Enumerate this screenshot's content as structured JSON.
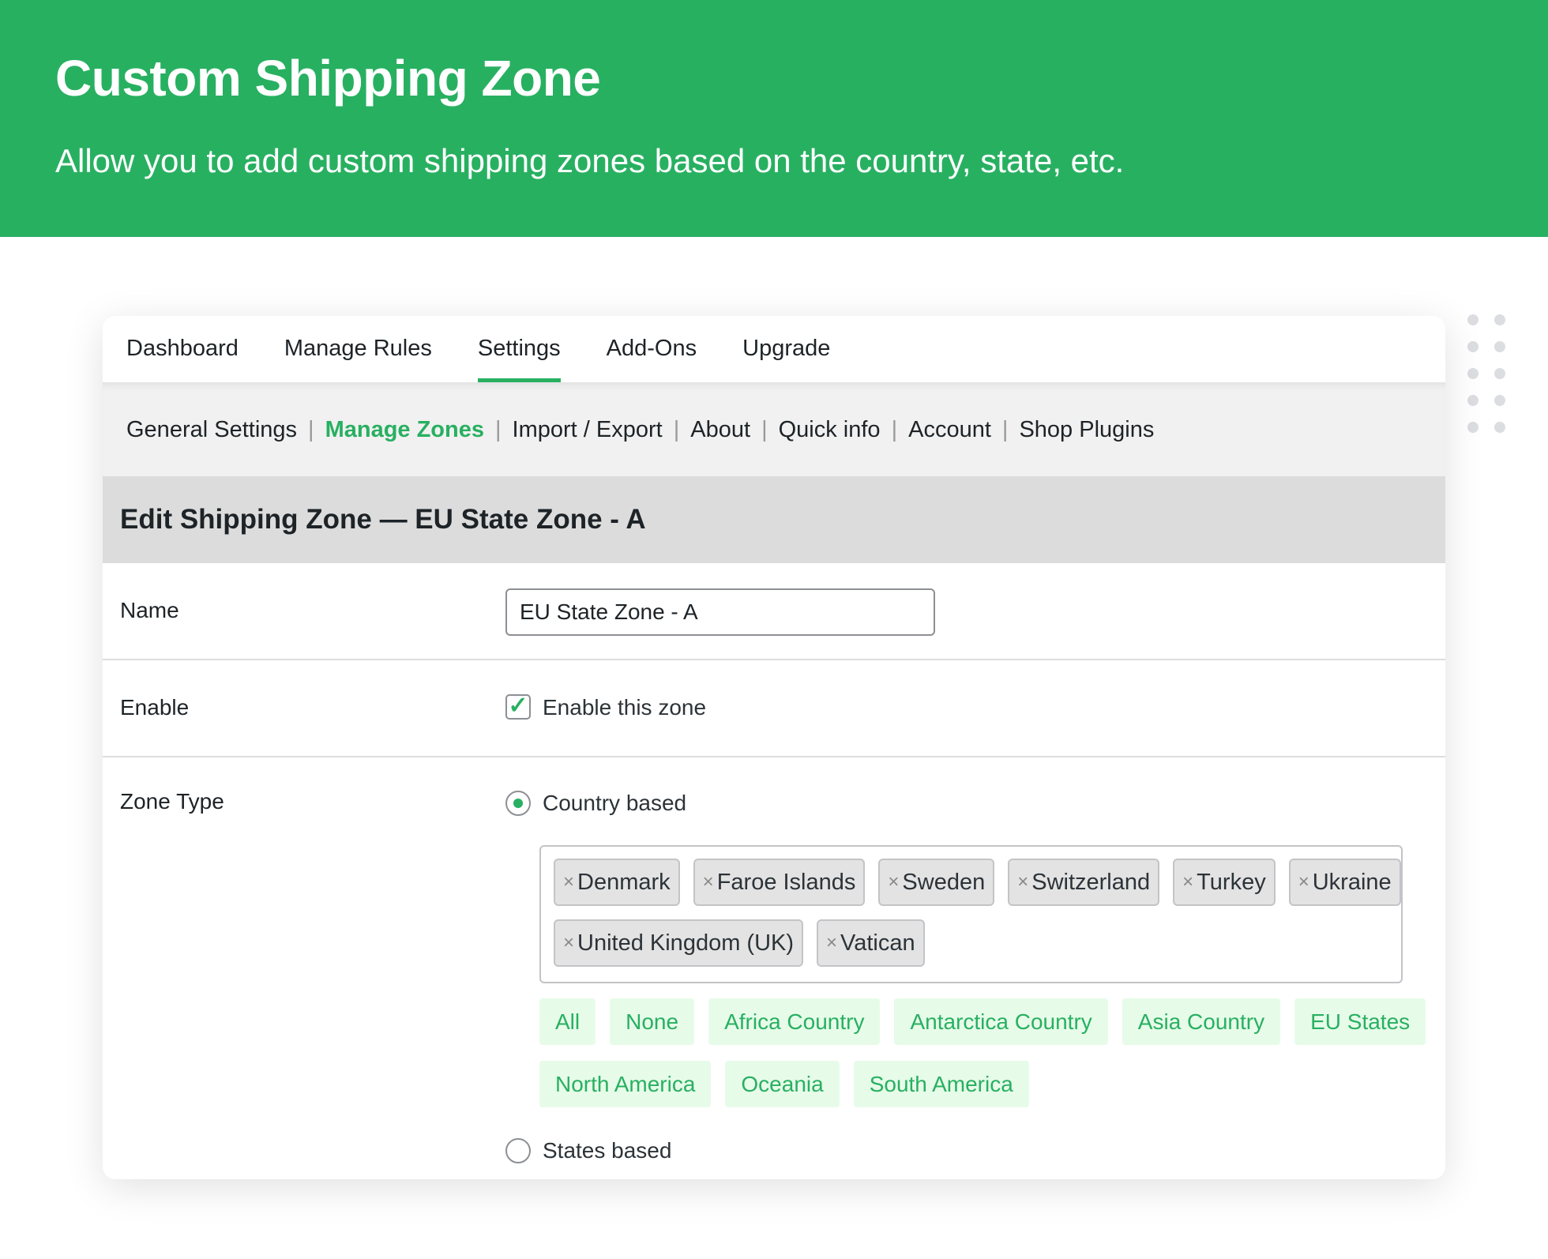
{
  "hero": {
    "title": "Custom Shipping Zone",
    "subtitle": "Allow you to add custom shipping zones based on the country, state, etc."
  },
  "colors": {
    "brand": "#28b061",
    "quick_bg": "#e7fbe9"
  },
  "nav": {
    "items": [
      "Dashboard",
      "Manage Rules",
      "Settings",
      "Add-Ons",
      "Upgrade"
    ],
    "active": "Settings"
  },
  "subnav": {
    "items": [
      "General Settings",
      "Manage Zones",
      "Import / Export",
      "About",
      "Quick info",
      "Account",
      "Shop Plugins"
    ],
    "active": "Manage Zones"
  },
  "heading": "Edit Shipping Zone — EU State Zone - A",
  "form": {
    "name_label": "Name",
    "name_value": "EU State Zone - A",
    "enable_label": "Enable",
    "enable_text": "Enable this zone",
    "enable_checked": true,
    "zone_type_label": "Zone Type",
    "country_based": "Country based",
    "states_based": "States based",
    "selected": "Country based",
    "tags": [
      "Denmark",
      "Faroe Islands",
      "Sweden",
      "Switzerland",
      "Turkey",
      "Ukraine",
      "United Kingdom (UK)",
      "Vatican"
    ],
    "tag_remove": "×",
    "quick_select": [
      "All",
      "None",
      "Africa Country",
      "Antarctica Country",
      "Asia Country",
      "EU States",
      "North America",
      "Oceania",
      "South America"
    ]
  }
}
